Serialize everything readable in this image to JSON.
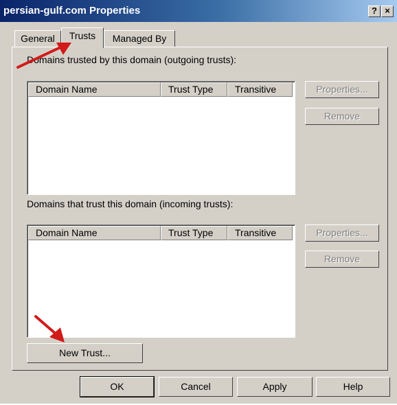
{
  "window": {
    "title": "persian-gulf.com Properties",
    "help_glyph": "?",
    "close_glyph": "×"
  },
  "tabs": [
    {
      "label": "General"
    },
    {
      "label": "Trusts"
    },
    {
      "label": "Managed By"
    }
  ],
  "outgoing": {
    "label": "Domains trusted by this domain (outgoing trusts):",
    "columns": [
      "Domain Name",
      "Trust Type",
      "Transitive"
    ],
    "properties_label": "Properties...",
    "remove_label": "Remove"
  },
  "incoming": {
    "label": "Domains that trust this domain (incoming trusts):",
    "columns": [
      "Domain Name",
      "Trust Type",
      "Transitive"
    ],
    "properties_label": "Properties...",
    "remove_label": "Remove"
  },
  "new_trust_label": "New Trust...",
  "footer": {
    "ok_label": "OK",
    "cancel_label": "Cancel",
    "apply_label": "Apply",
    "help_label": "Help"
  },
  "colors": {
    "titlebar_start": "#0a246a",
    "titlebar_end": "#a6caf0",
    "face": "#d4d0c8",
    "annotation_arrow": "#d11a1a"
  },
  "icons": {
    "annotation": "red-arrow-icon"
  }
}
